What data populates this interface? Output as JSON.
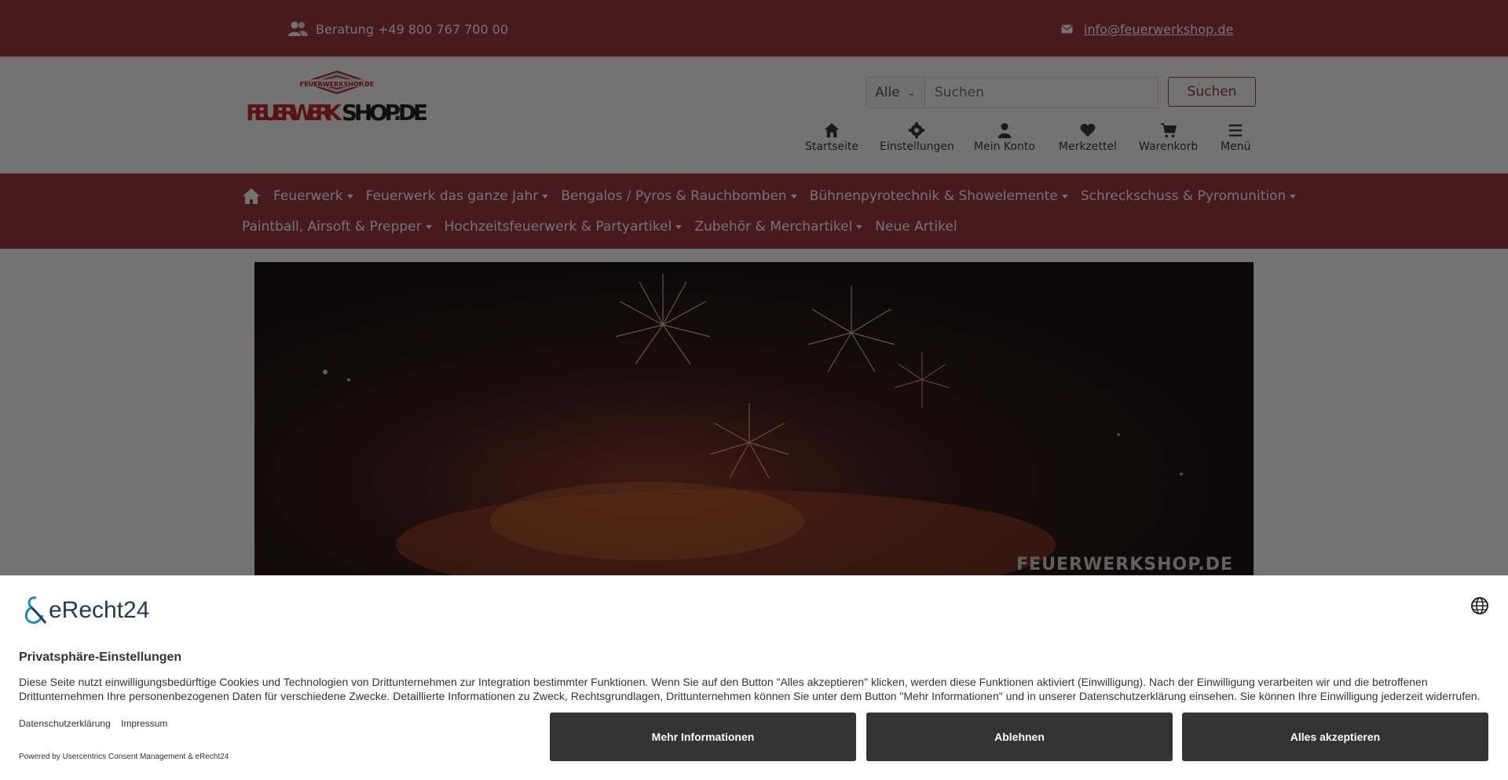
{
  "topbar": {
    "phone": "Beratung +49 800 767 700 00",
    "email": "info@feuerwerkshop.de"
  },
  "header": {
    "logo_text": "FEUERWERKSHOP.DE",
    "search": {
      "category": "Alle",
      "placeholder": "Suchen",
      "button": "Suchen"
    },
    "icons": [
      {
        "label": "Startseite",
        "icon": "home-icon"
      },
      {
        "label": "Einstellungen",
        "icon": "gear-icon"
      },
      {
        "label": "Mein Konto",
        "icon": "user-icon"
      },
      {
        "label": "Merkzettel",
        "icon": "heart-icon"
      },
      {
        "label": "Warenkorb",
        "icon": "cart-icon"
      },
      {
        "label": "Menü",
        "icon": "hamburger-icon"
      }
    ]
  },
  "nav": {
    "row1": [
      "Feuerwerk",
      "Feuerwerk das ganze Jahr",
      "Bengalos / Pyros & Rauchbomben",
      "Bühnenpyrotechnik & Showelemente",
      "Schreckschuss & Pyromunition"
    ],
    "row2": [
      "Paintball, Airsoft & Prepper",
      "Hochzeitsfeuerwerk & Partyartikel",
      "Zubehör & Merchartikel",
      "Neue Artikel"
    ]
  },
  "hero": {
    "watermark": "FEUERWERKSHOP.DE"
  },
  "consent": {
    "brand": "eRecht24",
    "title": "Privatsphäre-Einstellungen",
    "description": "Diese Seite nutzt einwilligungsbedürftige Cookies und Technologien von Drittunternehmen zur Integration bestimmter Funktionen. Wenn Sie auf den Button \"Alles akzeptieren\" klicken, werden diese Funktionen aktiviert (Einwilligung). Nach der Einwilligung verarbeiten wir und die betroffenen Drittunternehmen Ihre personenbezogenen Daten für verschiedene Zwecke. Detaillierte Informationen zu Zweck, Rechtsgrundlagen, Drittunternehmen können Sie unter dem Button \"Mehr Informationen\" und in unserer Datenschutzerklärung einsehen. Sie können Ihre Einwilligung jederzeit widerrufen.",
    "links": [
      "Datenschutzerklärung",
      "Impressum"
    ],
    "powered": "Powered by Usercentrics Consent Management & eRecht24",
    "buttons": [
      "Mehr Informationen",
      "Ablehnen",
      "Alles akzeptieren"
    ]
  },
  "colors": {
    "brand_red": "#9d3a44",
    "button_dark": "#333333"
  }
}
